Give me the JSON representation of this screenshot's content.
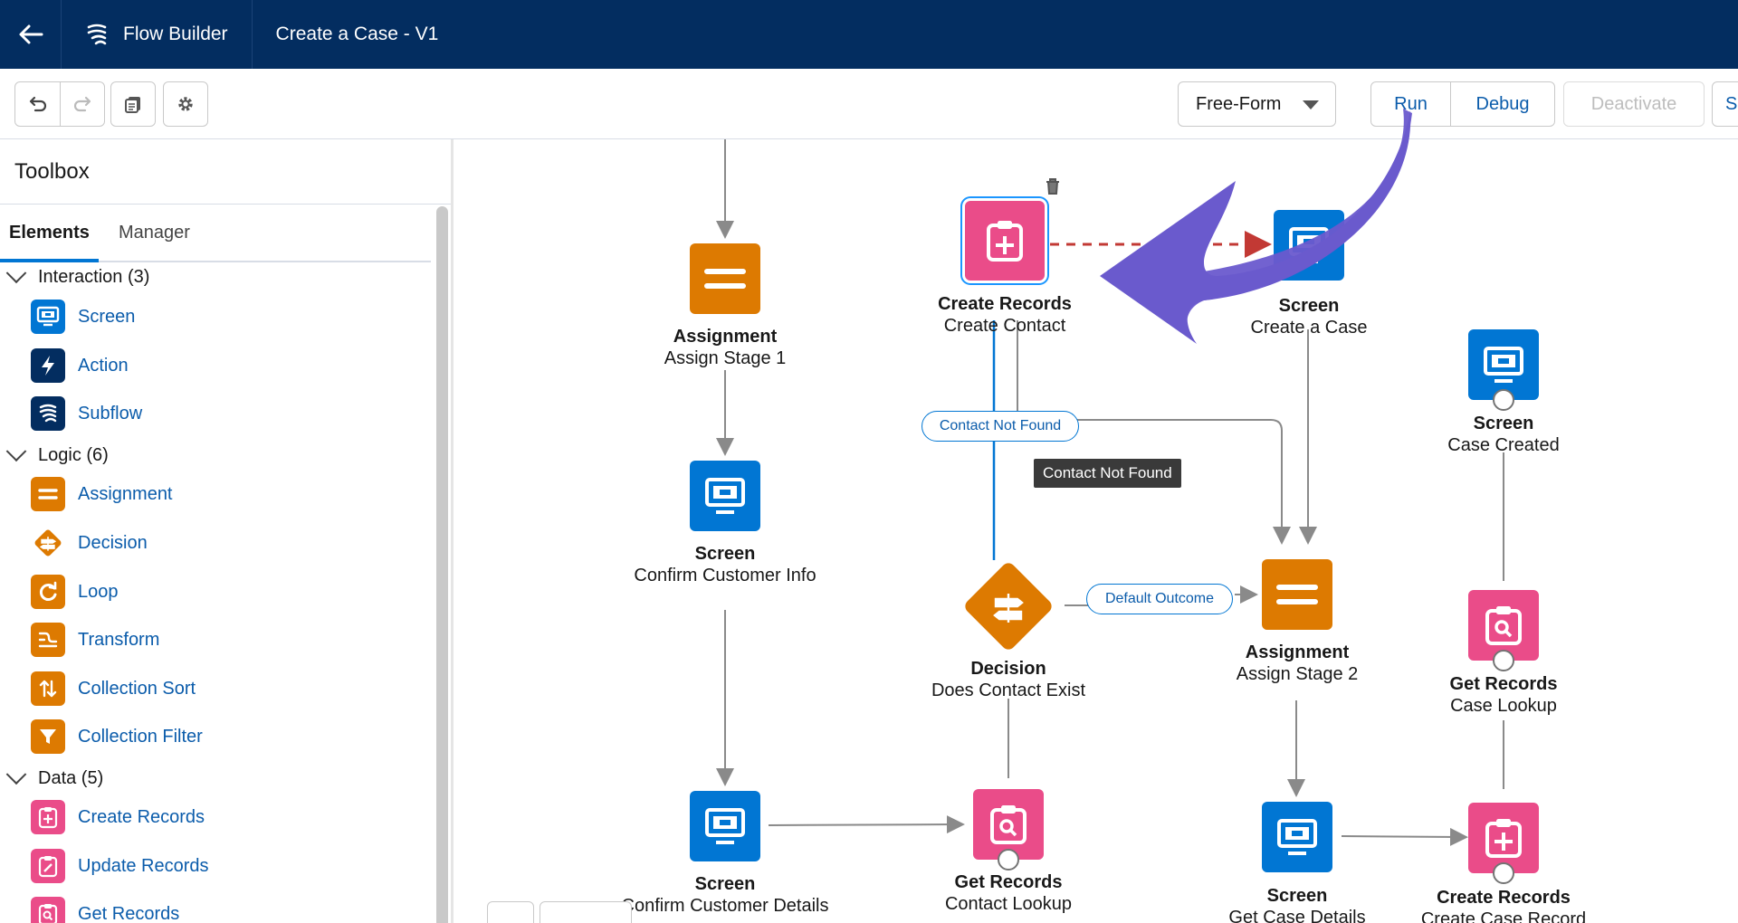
{
  "header": {
    "app_name": "Flow Builder",
    "flow_title": "Create a Case - V1"
  },
  "toolbar": {
    "layout_select": "Free-Form",
    "run_label": "Run",
    "debug_label": "Debug",
    "deactivate_label": "Deactivate"
  },
  "toolbox": {
    "title": "Toolbox",
    "tabs": [
      "Elements",
      "Manager"
    ],
    "categories": [
      {
        "label": "Interaction (3)",
        "items": [
          "Screen",
          "Action",
          "Subflow"
        ]
      },
      {
        "label": "Logic (6)",
        "items": [
          "Assignment",
          "Decision",
          "Loop",
          "Transform",
          "Collection Sort",
          "Collection Filter"
        ]
      },
      {
        "label": "Data (5)",
        "items": [
          "Create Records",
          "Update Records",
          "Get Records"
        ]
      }
    ]
  },
  "canvas": {
    "nodes": [
      {
        "type": "Assignment",
        "name": "Assign Stage 1"
      },
      {
        "type": "Screen",
        "name": "Confirm Customer Info"
      },
      {
        "type": "Screen",
        "name": "Confirm Customer Details"
      },
      {
        "type": "Create Records",
        "name": "Create Contact"
      },
      {
        "type": "Decision",
        "name": "Does Contact Exist"
      },
      {
        "type": "Get Records",
        "name": "Contact Lookup"
      },
      {
        "type": "Screen",
        "name": "Create a Case"
      },
      {
        "type": "Assignment",
        "name": "Assign Stage 2"
      },
      {
        "type": "Screen",
        "name": "Get Case Details"
      },
      {
        "type": "Screen",
        "name": "Case Created"
      },
      {
        "type": "Get Records",
        "name": "Case Lookup"
      },
      {
        "type": "Create Records",
        "name": "Create Case Record"
      }
    ],
    "connectors": {
      "contact_not_found": "Contact Not Found",
      "tooltip": "Contact Not Found",
      "default_outcome": "Default Outcome"
    }
  },
  "colors": {
    "header_bg": "#032d60",
    "screen": "#0176d3",
    "action": "#032d60",
    "logic": "#dd7a01",
    "data": "#ea4c89",
    "link": "#0b5cab",
    "annotation_arrow": "#6a5acd"
  }
}
